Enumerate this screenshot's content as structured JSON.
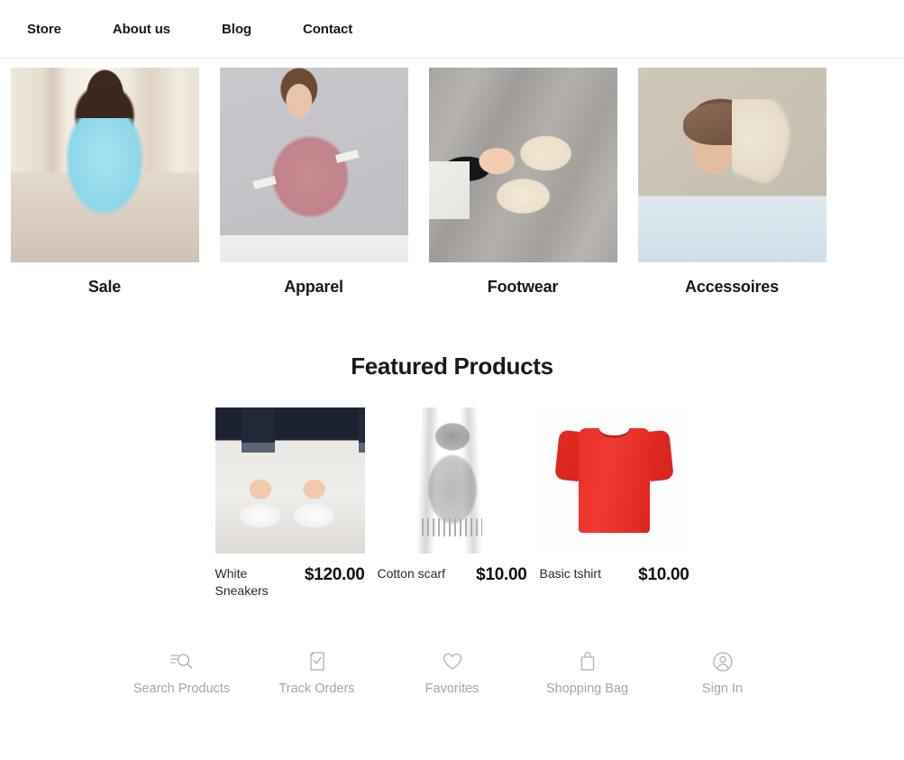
{
  "header": {
    "nav": [
      {
        "label": "Store",
        "name": "nav-item-store"
      },
      {
        "label": "About us",
        "name": "nav-item-about-us"
      },
      {
        "label": "Blog",
        "name": "nav-item-blog"
      },
      {
        "label": "Contact",
        "name": "nav-item-contact"
      }
    ]
  },
  "categories": [
    {
      "label": "Sale",
      "image": "woman-in-light-blue-dress"
    },
    {
      "label": "Apparel",
      "image": "woman-in-pink-sweater"
    },
    {
      "label": "Footwear",
      "image": "cream-oxford-shoes"
    },
    {
      "label": "Accessoires",
      "image": "woman-wearing-cap"
    }
  ],
  "featured": {
    "title": "Featured Products",
    "products": [
      {
        "name": "White Sneakers",
        "price": "$120.00",
        "image": "white-canvas-sneakers"
      },
      {
        "name": "Cotton scarf",
        "price": "$10.00",
        "image": "gray-fringed-scarf"
      },
      {
        "name": "Basic tshirt",
        "price": "$10.00",
        "image": "red-tshirt"
      }
    ]
  },
  "toolbar": [
    {
      "label": "Search Products",
      "icon": "search-icon"
    },
    {
      "label": "Track Orders",
      "icon": "checklist-document-icon"
    },
    {
      "label": "Favorites",
      "icon": "heart-icon"
    },
    {
      "label": "Shopping Bag",
      "icon": "shopping-bag-icon"
    },
    {
      "label": "Sign In",
      "icon": "user-circle-icon"
    }
  ],
  "colors": {
    "text_primary": "#1a1a1a",
    "text_muted": "#a6a6a6",
    "background": "#ffffff",
    "border": "#e9e9e9",
    "tshirt_red": "#e8302a"
  }
}
